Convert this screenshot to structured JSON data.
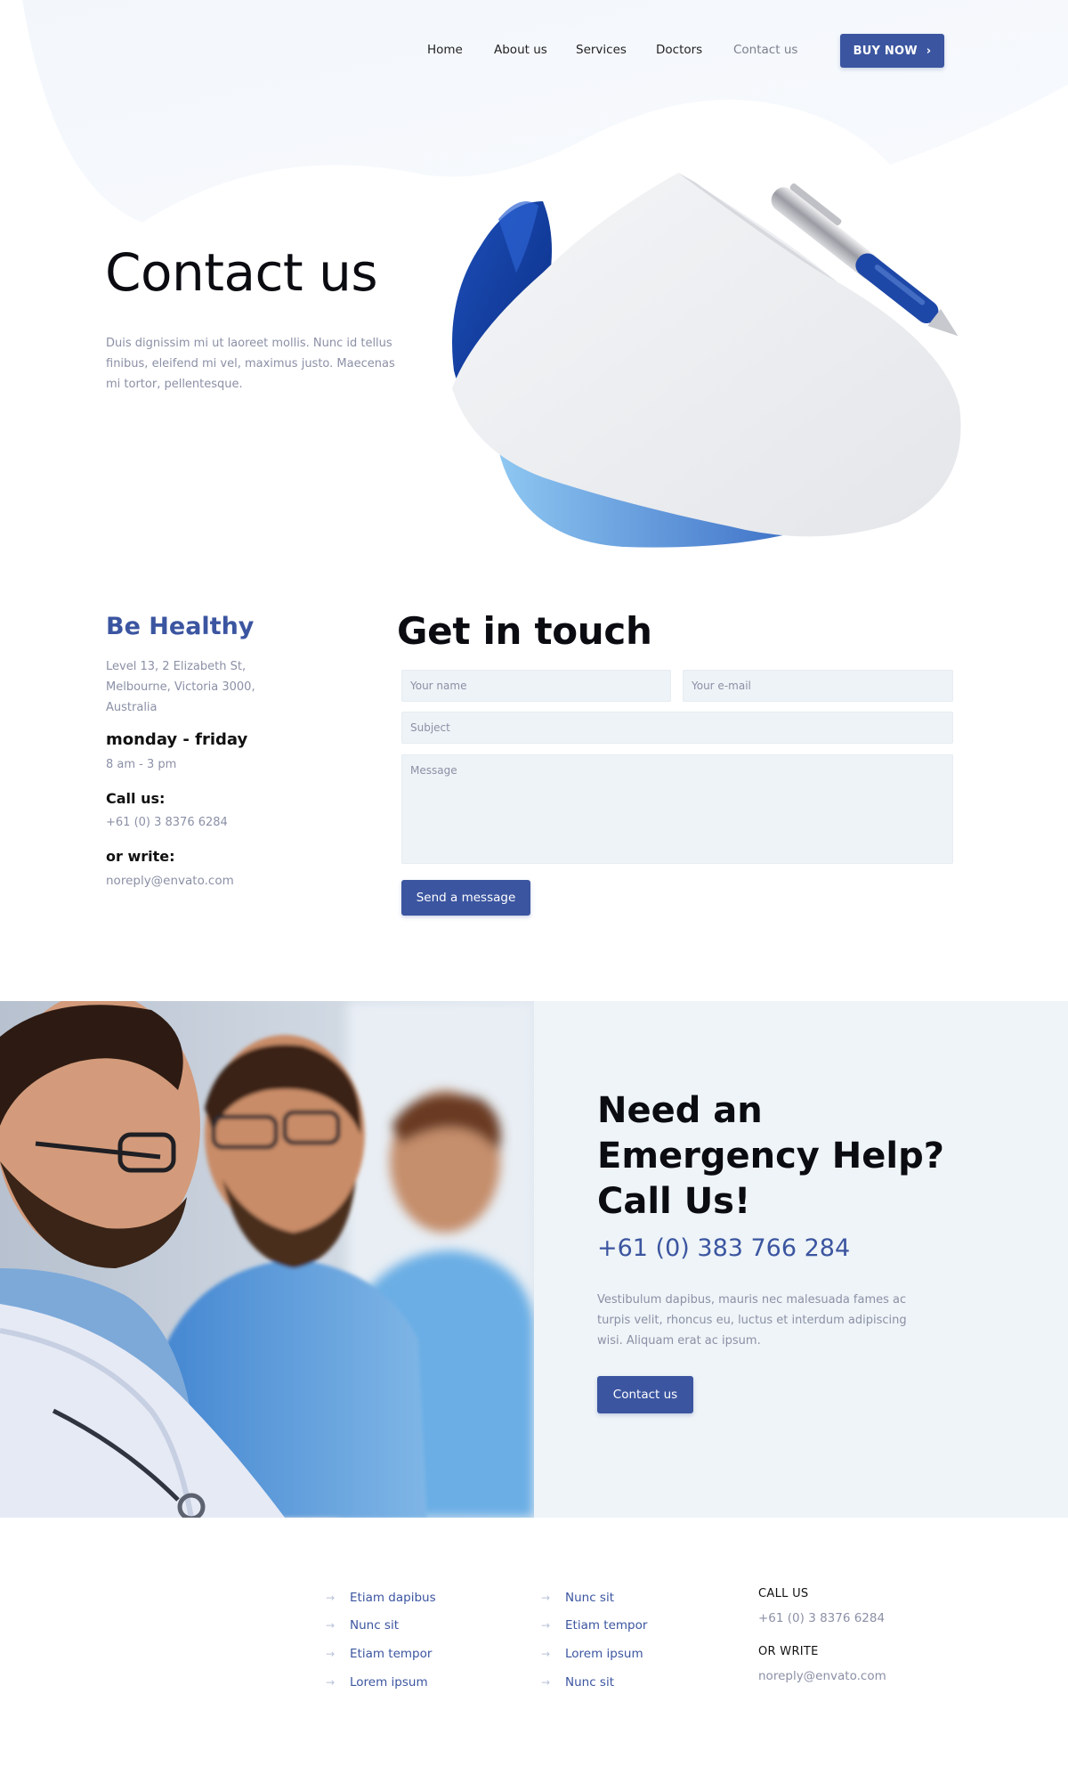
{
  "nav": {
    "items": [
      {
        "label": "Home",
        "active": false
      },
      {
        "label": "About us",
        "active": false
      },
      {
        "label": "Services",
        "active": false
      },
      {
        "label": "Doctors",
        "active": false
      },
      {
        "label": "Contact us",
        "active": true
      }
    ],
    "buy_button": "BUY NOW",
    "buy_icon": "chevron-right-icon"
  },
  "hero": {
    "title": "Contact us",
    "description": "Duis dignissim mi ut laoreet mollis. Nunc id tellus finibus, eleifend mi vel, maximus justo. Maecenas mi tortor, pellentesque."
  },
  "info": {
    "title": "Be Healthy",
    "address": "Level 13, 2 Elizabeth St, Melbourne, Victoria 3000, Australia",
    "hours_label": "monday - friday",
    "hours": "8 am - 3 pm",
    "call_label": "Call us:",
    "phone": "+61 (0) 3 8376 6284",
    "write_label": "or write:",
    "email": "noreply@envato.com"
  },
  "form": {
    "title": "Get in touch",
    "name_placeholder": "Your name",
    "email_placeholder": "Your e-mail",
    "subject_placeholder": "Subject",
    "message_placeholder": "Message",
    "submit_label": "Send a message"
  },
  "emergency": {
    "title": "Need an Emergency Help? Call Us!",
    "phone": "+61 (0) 383 766 284",
    "description": "Vestibulum dapibus, mauris nec malesuada fames ac turpis velit, rhoncus eu, luctus et interdum adipiscing wisi. Aliquam erat ac ipsum.",
    "button": "Contact us"
  },
  "footer": {
    "col1": [
      "Etiam dapibus",
      "Nunc sit",
      "Etiam tempor",
      "Lorem ipsum"
    ],
    "col2": [
      "Nunc sit",
      "Etiam tempor",
      "Lorem ipsum",
      "Nunc sit"
    ],
    "call_heading": "CALL US",
    "phone": "+61 (0) 3 8376 6284",
    "write_heading": "OR WRITE",
    "email": "noreply@envato.com",
    "arrow_icon": "arrow-right-icon"
  },
  "colors": {
    "brand": "#3b55a0",
    "muted_text": "#8b90a6",
    "panel_bg": "#eef4f7",
    "field_bg": "#eef3f7"
  }
}
